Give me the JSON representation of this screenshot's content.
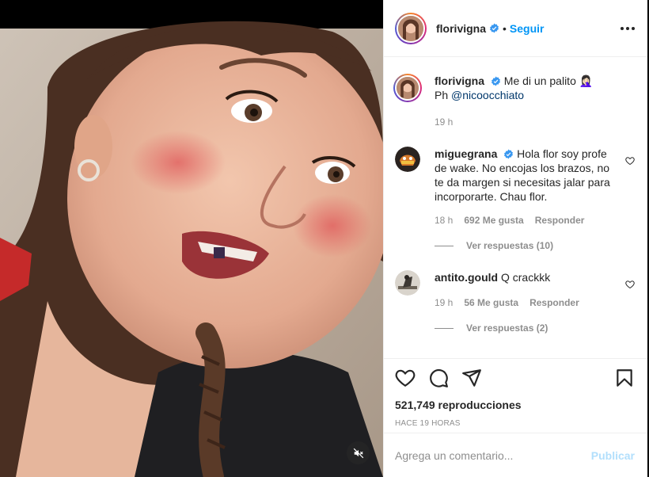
{
  "post": {
    "author": "florivigna",
    "follow_label": "Seguir",
    "more_icon": "more-options-icon",
    "caption": {
      "author": "florivigna",
      "text": "Me di un palito",
      "emoji": "🤦🏻‍♀️",
      "credit_prefix": "Ph",
      "credit_mention": "@nicoocchiato",
      "time": "19 h"
    },
    "comments": [
      {
        "author": "miguegrana",
        "verified": true,
        "text": "Hola flor soy profe de wake. No encojas los brazos, no te da margen si necesitas jalar para incorporarte. Chau flor.",
        "time": "18 h",
        "likes": "692 Me gusta",
        "reply_label": "Responder",
        "view_replies": "Ver respuestas (10)"
      },
      {
        "author": "antito.gould",
        "verified": false,
        "text": "Q crackkk",
        "time": "19 h",
        "likes": "56 Me gusta",
        "reply_label": "Responder",
        "view_replies": "Ver respuestas (2)"
      }
    ],
    "views": "521,749 reproducciones",
    "posted_ago": "HACE 19 HORAS",
    "comment_placeholder": "Agrega un comentario...",
    "publish_label": "Publicar"
  },
  "colors": {
    "link_blue": "#0095f6",
    "publish_disabled": "#b2dffc",
    "secondary_text": "#8e8e8e",
    "verified_badge": "#3897f0"
  }
}
